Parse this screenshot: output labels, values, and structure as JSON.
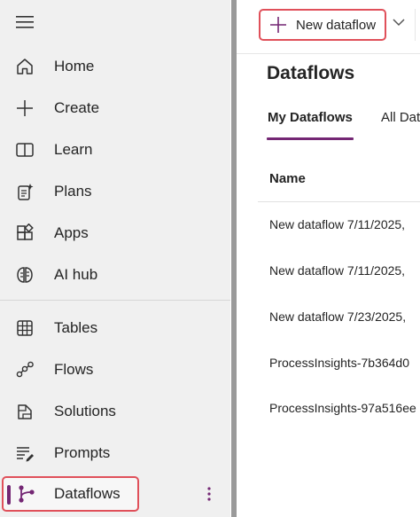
{
  "sidebar": {
    "items": [
      {
        "label": "Home",
        "icon": "home-icon"
      },
      {
        "label": "Create",
        "icon": "plus-icon"
      },
      {
        "label": "Learn",
        "icon": "book-icon"
      },
      {
        "label": "Plans",
        "icon": "plans-icon"
      },
      {
        "label": "Apps",
        "icon": "apps-icon"
      },
      {
        "label": "AI hub",
        "icon": "ai-hub-icon"
      },
      {
        "label": "Tables",
        "icon": "table-icon"
      },
      {
        "label": "Flows",
        "icon": "flows-icon"
      },
      {
        "label": "Solutions",
        "icon": "solutions-icon"
      },
      {
        "label": "Prompts",
        "icon": "prompts-icon"
      },
      {
        "label": "Dataflows",
        "icon": "dataflows-icon",
        "selected": true
      }
    ],
    "more_icon": "more-vertical-icon"
  },
  "toolbar": {
    "new_label": "New dataflow"
  },
  "main": {
    "title": "Dataflows",
    "tabs": [
      {
        "label": "My Dataflows",
        "active": true
      },
      {
        "label": "All Dat"
      }
    ],
    "column_name": "Name",
    "rows": [
      "New dataflow 7/11/2025,",
      "New dataflow 7/11/2025,",
      "New dataflow 7/23/2025,",
      "ProcessInsights-7b364d0",
      "ProcessInsights-97a516ee"
    ]
  },
  "colors": {
    "accent": "#742774",
    "highlight": "#e0505a",
    "sidebar_bg": "#f0f0f0"
  }
}
